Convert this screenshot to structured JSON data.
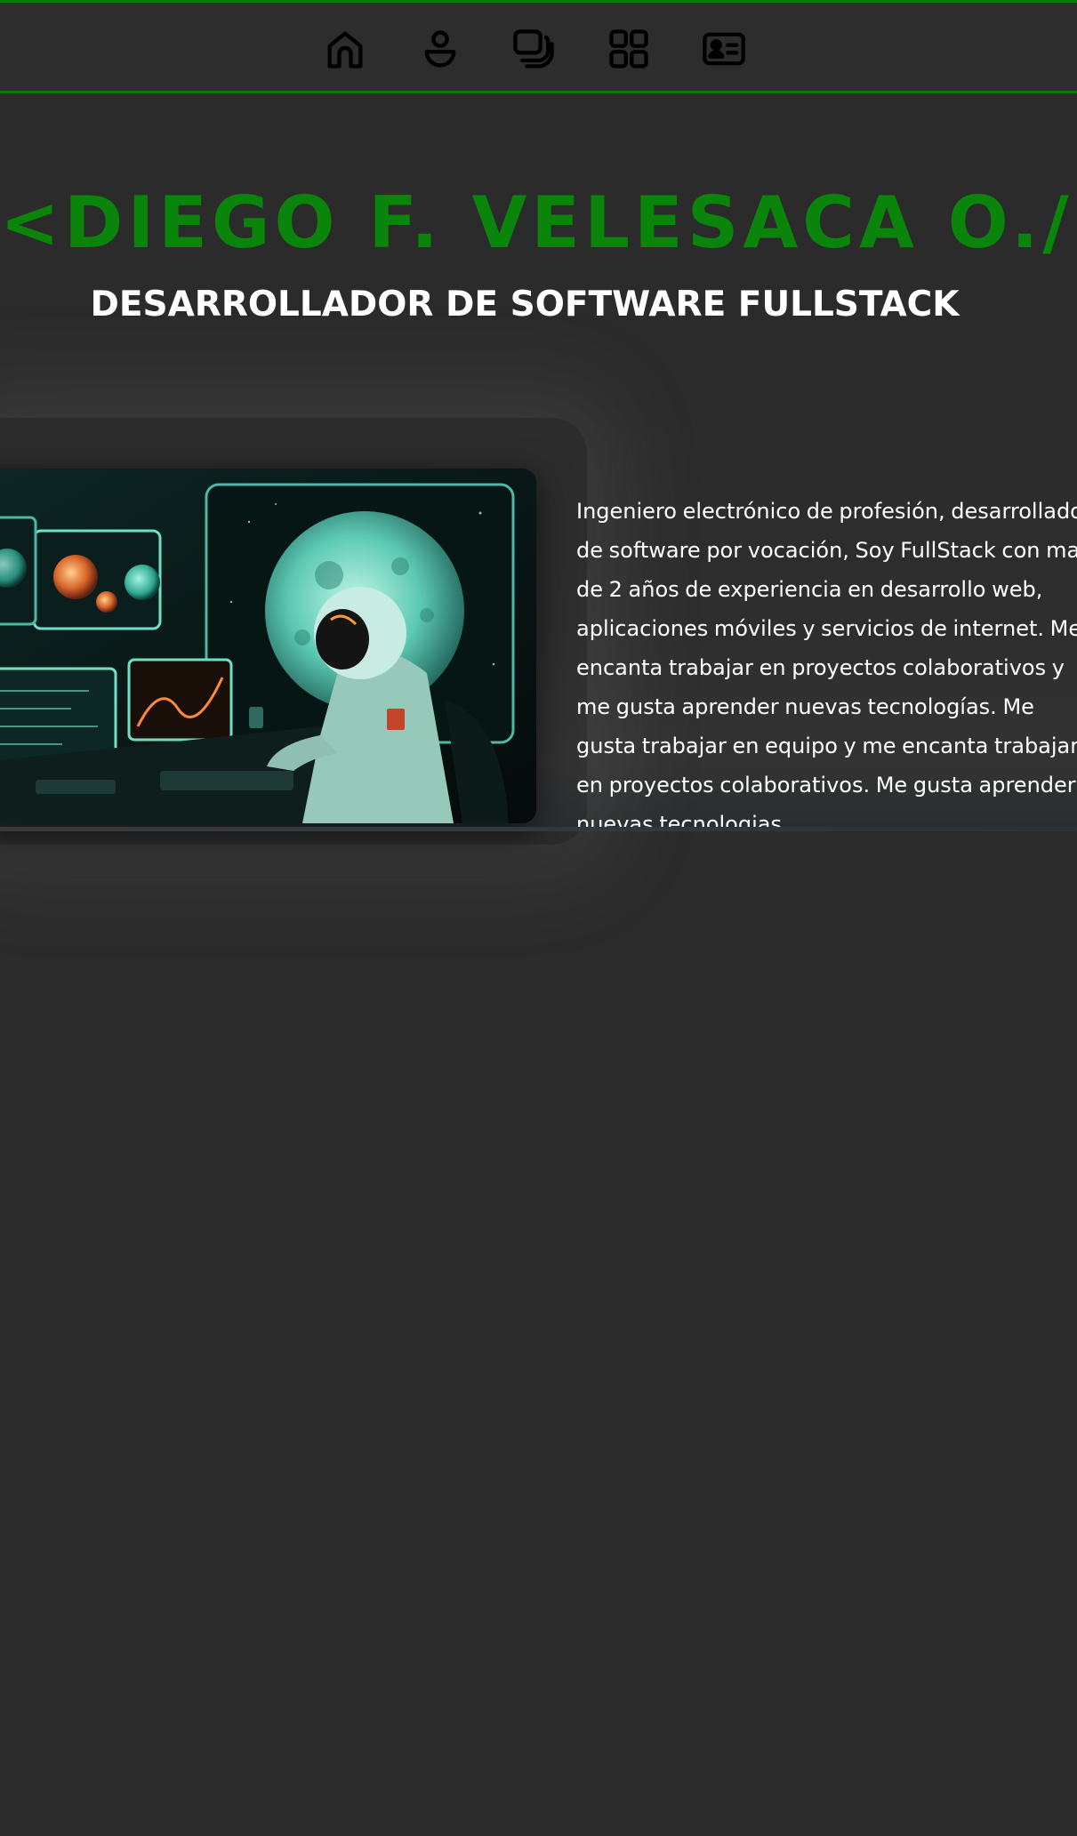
{
  "nav": {
    "items": [
      {
        "icon": "home-icon"
      },
      {
        "icon": "user-icon"
      },
      {
        "icon": "stack-icon"
      },
      {
        "icon": "grid-icon"
      },
      {
        "icon": "contact-card-icon"
      }
    ],
    "border_color": "#0b7a0b"
  },
  "hero": {
    "name": "<DIEGO F. VELESACA O./>",
    "role": "DESARROLLADOR DE SOFTWARE FULLSTACK",
    "accent": "#0a840a"
  },
  "about": {
    "image": "astronaut-workstation-illustration",
    "text": "Ingeniero electrónico de profesión, desarrollador de software por vocación, Soy FullStack con mas de 2 años de experiencia en desarrollo web, aplicaciones móviles y servicios de internet. Me encanta trabajar en proyectos colaborativos y me gusta aprender nuevas tecnologías. Me gusta trabajar en equipo y me encanta trabajar en proyectos colaborativos. Me gusta aprender nuevas tecnologias."
  }
}
